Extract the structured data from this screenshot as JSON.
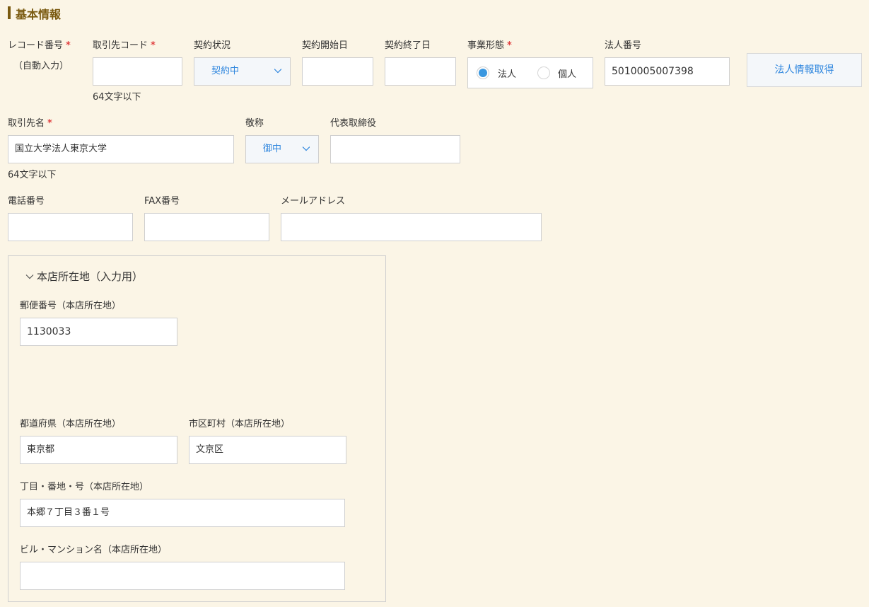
{
  "section": {
    "title": "基本情報"
  },
  "row1": {
    "record_no": {
      "label": "レコード番号",
      "required": "*",
      "value": "（自動入力）"
    },
    "client_code": {
      "label": "取引先コード",
      "required": "*",
      "value": "",
      "note": "64文字以下"
    },
    "contract_status": {
      "label": "契約状況",
      "value": "契約中"
    },
    "contract_start": {
      "label": "契約開始日",
      "value": ""
    },
    "contract_end": {
      "label": "契約終了日",
      "value": ""
    },
    "business_type": {
      "label": "事業形態",
      "required": "*",
      "options": [
        "法人",
        "個人"
      ],
      "selected": "法人"
    },
    "corp_number": {
      "label": "法人番号",
      "value": "5010005007398"
    },
    "fetch_button": "法人情報取得"
  },
  "row2": {
    "client_name": {
      "label": "取引先名",
      "required": "*",
      "value": "国立大学法人東京大学",
      "note": "64文字以下"
    },
    "honorific": {
      "label": "敬称",
      "value": "御中"
    },
    "representative": {
      "label": "代表取締役",
      "value": ""
    }
  },
  "row3": {
    "phone": {
      "label": "電話番号",
      "value": ""
    },
    "fax": {
      "label": "FAX番号",
      "value": ""
    },
    "email": {
      "label": "メールアドレス",
      "value": ""
    }
  },
  "address": {
    "title": "本店所在地（入力用）",
    "postal": {
      "label": "郵便番号（本店所在地）",
      "value": "1130033"
    },
    "prefecture": {
      "label": "都道府県（本店所在地）",
      "value": "東京都"
    },
    "city": {
      "label": "市区町村（本店所在地）",
      "value": "文京区"
    },
    "street": {
      "label": "丁目・番地・号（本店所在地）",
      "value": "本郷７丁目３番１号"
    },
    "building": {
      "label": "ビル・マンション名（本店所在地）",
      "value": ""
    }
  }
}
